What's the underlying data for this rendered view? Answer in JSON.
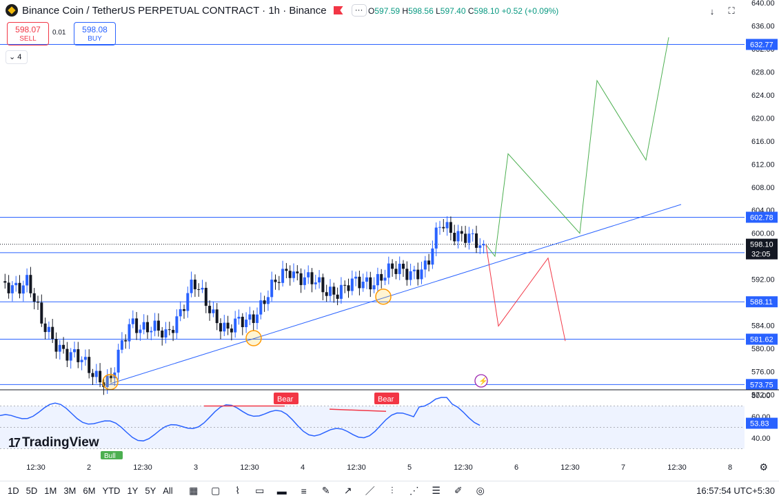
{
  "header": {
    "symbol_title": "Binance Coin / TetherUS PERPETUAL CONTRACT · 1h · Binance",
    "more_label": "···",
    "ohlc": {
      "o_k": "O",
      "o": "597.59",
      "h_k": "H",
      "h": "598.56",
      "l_k": "L",
      "l": "597.40",
      "c_k": "C",
      "c": "598.10",
      "chg": "+0.52 (+0.09%)"
    }
  },
  "trade": {
    "sell_price": "598.07",
    "sell_label": "SELL",
    "spread": "0.01",
    "buy_price": "598.08",
    "buy_label": "BUY"
  },
  "indicators_count": "4",
  "price_axis": {
    "ticks": [
      "640.00",
      "636.00",
      "632.00",
      "628.00",
      "624.00",
      "620.00",
      "616.00",
      "612.00",
      "608.00",
      "604.00",
      "600.00",
      "596.00",
      "592.00",
      "588.00",
      "584.00",
      "580.00",
      "576.00",
      "572.00"
    ],
    "levels": [
      {
        "price": 632.77,
        "label": "632.77"
      },
      {
        "price": 602.78,
        "label": "602.78"
      },
      {
        "price": 596.64,
        "label": "596.64"
      },
      {
        "price": 588.11,
        "label": "588.11"
      },
      {
        "price": 581.62,
        "label": "581.62"
      },
      {
        "price": 573.75,
        "label": "573.75"
      }
    ],
    "last_price": "598.10",
    "countdown": "32:05"
  },
  "rsi": {
    "ticks": [
      "80.00",
      "60.00",
      "40.00"
    ],
    "current": "53.83",
    "bear_labels": [
      "Bear",
      "Bear"
    ],
    "bull_label": "Bull"
  },
  "time_axis": [
    "12:30",
    "2",
    "12:30",
    "3",
    "12:30",
    "4",
    "12:30",
    "5",
    "12:30",
    "6",
    "12:30",
    "7",
    "12:30",
    "8"
  ],
  "branding": "TradingView",
  "timeframes": [
    "1D",
    "5D",
    "1M",
    "3M",
    "6M",
    "YTD",
    "1Y",
    "5Y",
    "All"
  ],
  "clock": "16:57:54 UTC+5:30",
  "colors": {
    "up": "#2962ff",
    "down": "#131722",
    "level": "#2962ff",
    "bull_path": "#4caf50",
    "bear_path": "#f23645",
    "rsi": "#2962ff"
  }
}
